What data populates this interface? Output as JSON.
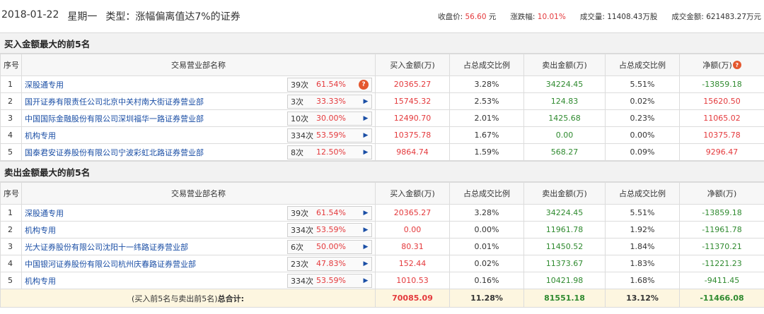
{
  "header": {
    "date": "2018-01-22",
    "weekday": "星期一",
    "type_text": "类型：涨幅偏离值达7%的证券",
    "close_label": "收盘价:",
    "close_value": "56.60",
    "close_unit": "元",
    "change_label": "涨跌幅:",
    "change_value": "10.01%",
    "volume_label": "成交量:",
    "volume_value": "11408.43万股",
    "turnover_label": "成交金额:",
    "turnover_value": "621483.27万元"
  },
  "columns": {
    "idx": "序号",
    "name": "交易营业部名称",
    "buy": "买入金额(万)",
    "buy_ratio": "占总成交比例",
    "sell": "卖出金额(万)",
    "sell_ratio": "占总成交比例",
    "net": "净额(万)"
  },
  "buy_section": {
    "title": "买入金额最大的前5名",
    "rows": [
      {
        "idx": "1",
        "name": "深股通专用",
        "count": "39次",
        "pct": "61.54%",
        "buy": "20365.27",
        "buy_ratio": "3.28%",
        "sell": "34224.45",
        "sell_ratio": "5.51%",
        "net": "-13859.18"
      },
      {
        "idx": "2",
        "name": "国开证券有限责任公司北京中关村南大街证券营业部",
        "count": "3次",
        "pct": "33.33%",
        "buy": "15745.32",
        "buy_ratio": "2.53%",
        "sell": "124.83",
        "sell_ratio": "0.02%",
        "net": "15620.50"
      },
      {
        "idx": "3",
        "name": "中国国际金融股份有限公司深圳福华一路证券营业部",
        "count": "10次",
        "pct": "30.00%",
        "buy": "12490.70",
        "buy_ratio": "2.01%",
        "sell": "1425.68",
        "sell_ratio": "0.23%",
        "net": "11065.02"
      },
      {
        "idx": "4",
        "name": "机构专用",
        "count": "334次",
        "pct": "53.59%",
        "buy": "10375.78",
        "buy_ratio": "1.67%",
        "sell": "0.00",
        "sell_ratio": "0.00%",
        "net": "10375.78"
      },
      {
        "idx": "5",
        "name": "国泰君安证券股份有限公司宁波彩虹北路证券营业部",
        "count": "8次",
        "pct": "12.50%",
        "buy": "9864.74",
        "buy_ratio": "1.59%",
        "sell": "568.27",
        "sell_ratio": "0.09%",
        "net": "9296.47"
      }
    ]
  },
  "sell_section": {
    "title": "卖出金额最大的前5名",
    "rows": [
      {
        "idx": "1",
        "name": "深股通专用",
        "count": "39次",
        "pct": "61.54%",
        "buy": "20365.27",
        "buy_ratio": "3.28%",
        "sell": "34224.45",
        "sell_ratio": "5.51%",
        "net": "-13859.18"
      },
      {
        "idx": "2",
        "name": "机构专用",
        "count": "334次",
        "pct": "53.59%",
        "buy": "0.00",
        "buy_ratio": "0.00%",
        "sell": "11961.78",
        "sell_ratio": "1.92%",
        "net": "-11961.78"
      },
      {
        "idx": "3",
        "name": "光大证券股份有限公司沈阳十一纬路证券营业部",
        "count": "6次",
        "pct": "50.00%",
        "buy": "80.31",
        "buy_ratio": "0.01%",
        "sell": "11450.52",
        "sell_ratio": "1.84%",
        "net": "-11370.21"
      },
      {
        "idx": "4",
        "name": "中国银河证券股份有限公司杭州庆春路证券营业部",
        "count": "23次",
        "pct": "47.83%",
        "buy": "152.44",
        "buy_ratio": "0.02%",
        "sell": "11373.67",
        "sell_ratio": "1.83%",
        "net": "-11221.23"
      },
      {
        "idx": "5",
        "name": "机构专用",
        "count": "334次",
        "pct": "53.59%",
        "buy": "1010.53",
        "buy_ratio": "0.16%",
        "sell": "10421.98",
        "sell_ratio": "1.68%",
        "net": "-9411.45"
      }
    ]
  },
  "total": {
    "label_prefix": "(买入前5名与卖出前5名)",
    "label_bold": "总合计:",
    "buy": "70085.09",
    "buy_ratio": "11.28%",
    "sell": "81551.18",
    "sell_ratio": "13.12%",
    "net": "-11466.08"
  },
  "icons": {
    "question": "?",
    "arrow": "▶"
  },
  "colors": {
    "red": "#e4393c",
    "green": "#2f8a2f",
    "link": "#1a4ea5",
    "question_bg": "#e4572e",
    "total_bg": "#fdf6e0"
  }
}
